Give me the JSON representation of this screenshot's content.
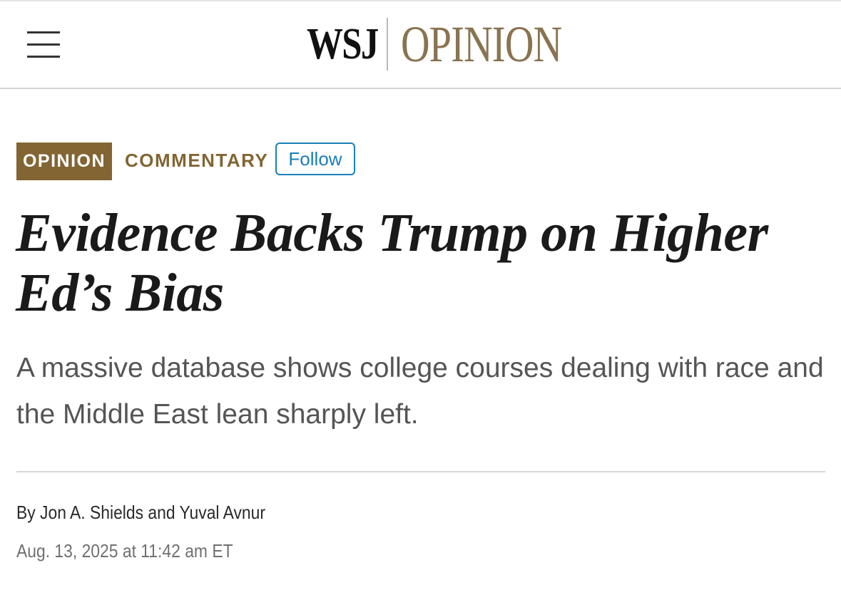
{
  "header": {
    "menu_icon": "hamburger-menu-icon",
    "brand_wsj": "WSJ",
    "brand_section": "OPINION"
  },
  "tags": {
    "section_tag": "OPINION",
    "category": "COMMENTARY",
    "follow_label": "Follow"
  },
  "article": {
    "headline": "Evidence Backs Trump on Higher Ed’s Bias",
    "dek": "A massive database shows college courses dealing with race and the Middle East lean sharply left.",
    "byline": "By Jon A. Shields and Yuval Avnur",
    "timestamp": "Aug. 13, 2025 at 11:42 am ET"
  },
  "colors": {
    "brand_gold": "#8a7351",
    "tag_background": "#826533",
    "follow_blue": "#1a7fb8"
  }
}
